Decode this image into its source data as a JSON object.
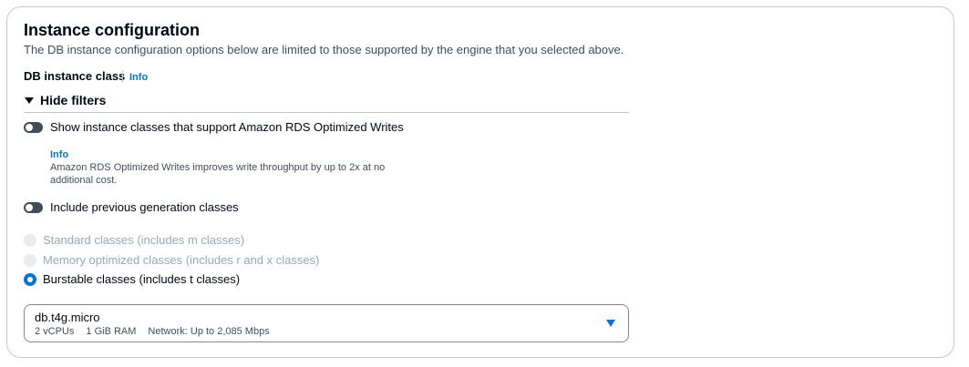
{
  "section": {
    "title": "Instance configuration",
    "description": "The DB instance configuration options below are limited to those supported by the engine that you selected above."
  },
  "instance_class": {
    "label": "DB instance class",
    "info_label": "Info"
  },
  "filters": {
    "toggle_label": "Hide filters",
    "expanded": true,
    "optimized_writes": {
      "label": "Show instance classes that support Amazon RDS Optimized Writes",
      "checked": false,
      "info_label": "Info",
      "help_text": "Amazon RDS Optimized Writes improves write throughput by up to 2x at no additional cost."
    },
    "previous_generation": {
      "label": "Include previous generation classes",
      "checked": false
    },
    "class_types": [
      {
        "label": "Standard classes (includes m classes)",
        "selected": false,
        "disabled": true
      },
      {
        "label": "Memory optimized classes (includes r and x classes)",
        "selected": false,
        "disabled": true
      },
      {
        "label": "Burstable classes (includes t classes)",
        "selected": true,
        "disabled": false
      }
    ]
  },
  "instance_select": {
    "value": "db.t4g.micro",
    "vcpus": "2 vCPUs",
    "ram": "1 GiB RAM",
    "network": "Network: Up to 2,085 Mbps"
  },
  "colors": {
    "accent": "#0972d3",
    "text": "#000716",
    "secondary_text": "#414d5c",
    "disabled_text": "#9ba7b6",
    "border": "#c6c6cd"
  },
  "icons": {
    "filters_toggle": "caret-down-filled-icon",
    "select_dropdown": "caret-down-filled-icon"
  }
}
